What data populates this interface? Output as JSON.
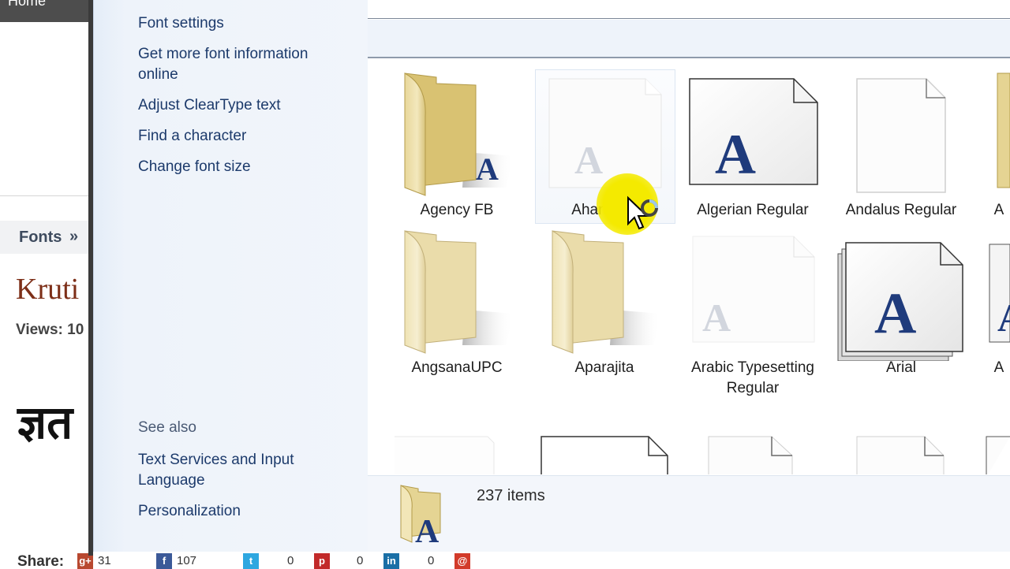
{
  "web_page": {
    "nav_home": "Home",
    "breadcrumb": {
      "label": "Fonts",
      "separator": "»"
    },
    "title": "Kruti",
    "views": "Views: 10",
    "sample": "ज्ञत",
    "share": {
      "label": "Share:",
      "items": [
        {
          "icon": "google-plus-icon",
          "count": "31"
        },
        {
          "icon": "facebook-icon",
          "count": "107"
        },
        {
          "icon": "twitter-icon",
          "count": "0"
        },
        {
          "icon": "pinterest-icon",
          "count": "0"
        },
        {
          "icon": "linkedin-icon",
          "count": "0"
        },
        {
          "icon": "mail-icon",
          "count": ""
        }
      ]
    }
  },
  "explorer": {
    "tasks": [
      "Font settings",
      "Get more font information online",
      "Adjust ClearType text",
      "Find a character",
      "Change font size"
    ],
    "see_also": {
      "heading": "See also",
      "links": [
        "Text Services and Input Language",
        "Personalization"
      ]
    },
    "fonts": [
      {
        "name": "Agency FB",
        "kind": "family"
      },
      {
        "name": "Aharoni Bold",
        "kind": "hidden",
        "label_visible": "Aharoni B"
      },
      {
        "name": "Algerian Regular",
        "kind": "font"
      },
      {
        "name": "Andalus Regular",
        "kind": "blank"
      },
      {
        "name": "A",
        "kind": "cut"
      },
      {
        "name": "AngsanaUPC",
        "kind": "family"
      },
      {
        "name": "Aparajita",
        "kind": "family"
      },
      {
        "name": "Arabic Typesetting Regular",
        "kind": "hidden"
      },
      {
        "name": "Arial",
        "kind": "stack"
      },
      {
        "name": "A",
        "kind": "cut"
      }
    ],
    "status": {
      "count": "237 items"
    }
  },
  "colors": {
    "link": "#1c3a6b",
    "font_glyph": "#1f3b7c",
    "cursor_highlight": "#f4ea00"
  }
}
